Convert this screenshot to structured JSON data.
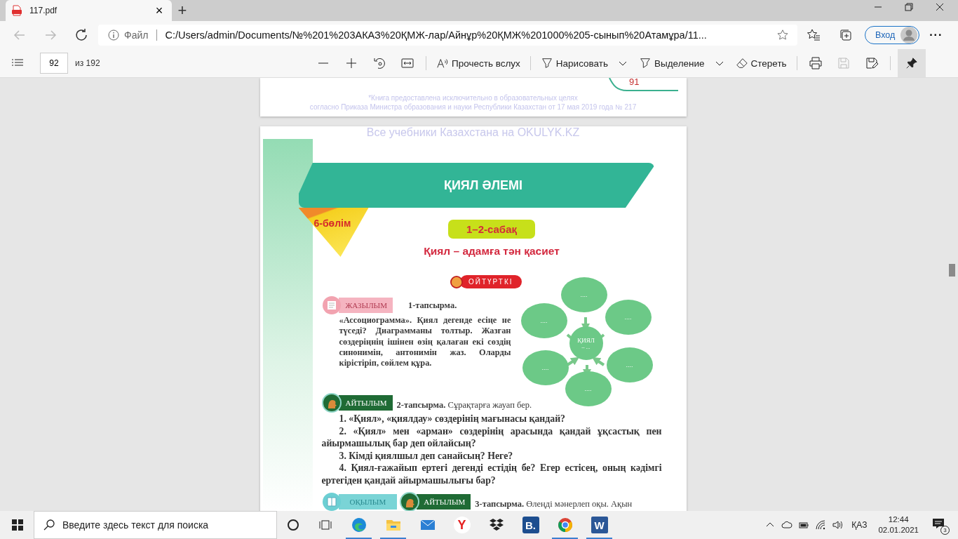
{
  "browser": {
    "tab": {
      "title": "117.pdf",
      "close": "×"
    },
    "new_tab": "+",
    "address": {
      "scheme": "Файл",
      "url": "C:/Users/admin/Documents/№%201%203АКАЗ%20ҚМЖ-лар/Айнұр%20ҚМЖ%201000%205-сынып%20Атамұра/11..."
    },
    "profile_button": "Вход",
    "more": "···"
  },
  "pdf_toolbar": {
    "page": "92",
    "page_count": "из 192",
    "read_aloud": "Прочесть вслух",
    "draw": "Нарисовать",
    "highlight": "Выделение",
    "erase": "Стереть",
    "save": {
      "disabled": true
    },
    "pin": {
      "selected": true
    }
  },
  "previous_page": {
    "page_number": "91",
    "footnote": [
      "*Книга предоставлена исключительно в образовательных целях",
      "согласно Приказа Министра образования и науки Республики Казахстан от 17 мая 2019 года № 217"
    ]
  },
  "page": {
    "header": "Все учебники Казахстана на OKULYK.KZ",
    "banner": "ҚИЯЛ ӘЛЕМІ",
    "section": "6-бөлім",
    "lesson": "1–2-сабақ",
    "subtitle": "Қиял – адамға тән қасиет",
    "badge": "ОЙТҮРТКІ",
    "task1": {
      "tags": [
        {
          "kind": "writing",
          "label": "ЖАЗЫЛЫМ"
        }
      ],
      "title": "1-тапсырма.",
      "text": "«Ассоциограмма». Қиял дегенде есіңе не түседі? Диаграмманы толтыр. Жазған сөздеріңнің ішінен өзің қалаған екі сөздің синонимін, антонимін жаз. Оларды кірістіріп, сөйлем құра."
    },
    "diagram": {
      "center": "ҚИЯЛ",
      "center_note": "– ...",
      "nodes": [
        "....",
        "....",
        "....",
        "....",
        "....",
        "...."
      ]
    },
    "task2": {
      "tags": [
        {
          "kind": "speaking",
          "label": "АЙТЫЛЫМ"
        }
      ],
      "text": "**2-тапсырма.** Сұрақтарға жауап бер.",
      "questions": [
        "1. «Қиял», «қиялдау» сөздерінің мағынасы қандай?",
        "2. «Қиял» мен «арман» сөздерінің арасында қандай ұқсастық пен айырмашылық бар деп ойлайсың?",
        "3. Кімді қиялшыл деп санайсың? Неге?",
        "4. Қиял-ғажайып ертегі дегенді естідің бе? Егер естісең, оның кәдімгі ертегіден қандай айырмашылығы бар?"
      ]
    },
    "task3": {
      "tags": [
        {
          "kind": "reading",
          "label": "ОҚЫЛЫМ"
        },
        {
          "kind": "speaking",
          "label": "АЙТЫЛЫМ"
        }
      ],
      "text": "**3-тапсырма.** Өлеңді мәнерлеп оқы. Ақын"
    }
  },
  "taskbar": {
    "search_placeholder": "Введите здесь текст для поиска",
    "apps": [
      {
        "kind": "edge",
        "running": true
      },
      {
        "kind": "explorer",
        "running": true
      },
      {
        "kind": "mail",
        "running": false
      },
      {
        "kind": "yandex",
        "glyph": "Y",
        "running": false
      },
      {
        "kind": "dropbox",
        "running": false
      },
      {
        "kind": "letter",
        "glyph": "B.",
        "running": false
      },
      {
        "kind": "chrome",
        "running": true
      },
      {
        "kind": "word",
        "glyph": "W",
        "running": true
      }
    ],
    "language": "ҚАЗ",
    "time": "12:44",
    "date": "02.01.2021",
    "notifications": "3"
  }
}
